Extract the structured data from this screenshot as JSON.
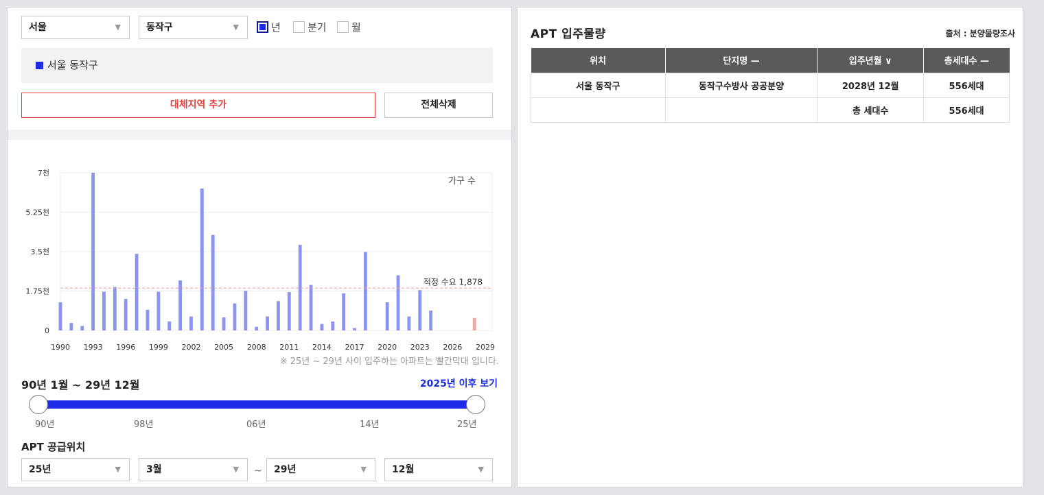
{
  "filters": {
    "region_select": "서울",
    "district_select": "동작구",
    "period_options": [
      {
        "label": "년",
        "checked": true
      },
      {
        "label": "분기",
        "checked": false
      },
      {
        "label": "월",
        "checked": false
      }
    ]
  },
  "selected_region": "서울 동작구",
  "buttons": {
    "add_region": "대체지역 추가",
    "delete_all": "전체삭제"
  },
  "chart_data": {
    "type": "bar",
    "series_name": "가구 수",
    "ylim": [
      0,
      7000
    ],
    "y_ticks": [
      "0",
      "1.75천",
      "3.5천",
      "5.25천",
      "7천"
    ],
    "x_ticks": [
      "1990",
      "1993",
      "1996",
      "1999",
      "2002",
      "2005",
      "2008",
      "2011",
      "2014",
      "2017",
      "2020",
      "2023",
      "2026",
      "2029"
    ],
    "years": [
      1990,
      1991,
      1992,
      1993,
      1994,
      1995,
      1996,
      1997,
      1998,
      1999,
      2000,
      2001,
      2002,
      2003,
      2004,
      2005,
      2006,
      2007,
      2008,
      2009,
      2010,
      2011,
      2012,
      2013,
      2014,
      2015,
      2016,
      2017,
      2018,
      2019,
      2020,
      2021,
      2022,
      2023,
      2024,
      2025,
      2026,
      2027,
      2028,
      2029
    ],
    "values": [
      1250,
      330,
      200,
      7000,
      1720,
      1930,
      1400,
      3400,
      920,
      1720,
      400,
      2220,
      620,
      6300,
      4240,
      580,
      1200,
      1760,
      160,
      620,
      1300,
      1700,
      3800,
      2020,
      290,
      400,
      1650,
      110,
      3480,
      0,
      1250,
      2450,
      620,
      1790,
      880,
      0,
      0,
      0,
      556,
      0
    ],
    "highlight_from": 2025,
    "reference": {
      "label": "적정 수요 1,878",
      "value": 1878
    },
    "colors": {
      "bar": "#8b94ee",
      "highlight": "#f2a9a3",
      "reference": "#f0a0a0"
    }
  },
  "chart_note": "※ 25년 ~ 29년 사이 입주하는 아파트는 빨간막대 입니다.",
  "range": {
    "period_label": "90년 1월 ~ 29년 12월",
    "after_link": "2025년 이후 보기",
    "slider_labels": [
      "90년",
      "98년",
      "06년",
      "14년",
      "25년"
    ]
  },
  "supply": {
    "title": "APT 공급위치",
    "from_year": "25년",
    "from_month": "3월",
    "tilde": "~",
    "to_year": "29년",
    "to_month": "12월"
  },
  "apt_table": {
    "title": "APT 입주물량",
    "source": "출처 : 분양물량조사",
    "headers": [
      "위치",
      "단지명 —",
      "입주년월 ∨",
      "총세대수 —"
    ],
    "rows": [
      [
        "서울 동작구",
        "동작구수방사 공공분양",
        "2028년 12월",
        "556세대"
      ],
      [
        "",
        "",
        "총 세대수",
        "556세대"
      ]
    ]
  }
}
